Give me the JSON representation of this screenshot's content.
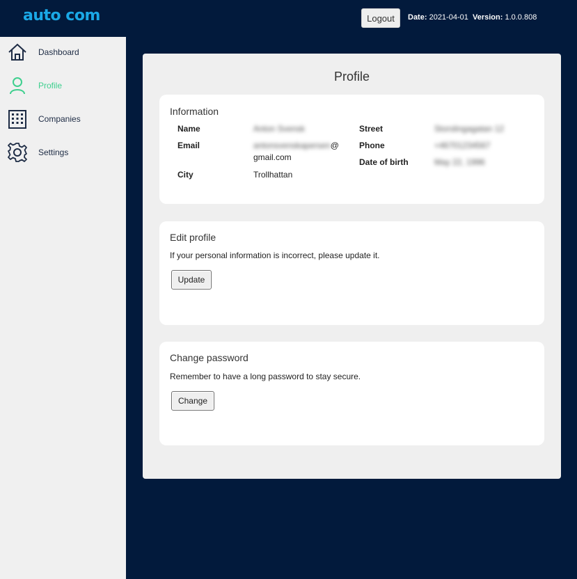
{
  "header": {
    "logo": "auto com",
    "logout_label": "Logout",
    "date_label": "Date:",
    "date_value": "2021-04-01",
    "version_label": "Version:",
    "version_value": "1.0.0.808"
  },
  "sidebar": {
    "items": [
      {
        "label": "Dashboard",
        "icon": "home-icon"
      },
      {
        "label": "Profile",
        "icon": "user-icon",
        "active": true
      },
      {
        "label": "Companies",
        "icon": "building-icon"
      },
      {
        "label": "Settings",
        "icon": "gear-icon"
      }
    ]
  },
  "main": {
    "title": "Profile",
    "information": {
      "title": "Information",
      "name_label": "Name",
      "name_value": "Anton Svensk",
      "email_label": "Email",
      "email_value_blurred": "antonsvenskapersen",
      "email_at": "@",
      "email_domain": "gmail.com",
      "city_label": "City",
      "city_value": "Trollhattan",
      "street_label": "Street",
      "street_value": "Storslingagatan 12",
      "phone_label": "Phone",
      "phone_value": "+46701234567",
      "dob_label": "Date of birth",
      "dob_value": "May 22, 1996"
    },
    "edit_profile": {
      "title": "Edit profile",
      "description": "If your personal information is incorrect, please update it.",
      "button_label": "Update"
    },
    "change_password": {
      "title": "Change password",
      "description": "Remember to have a long password to stay secure.",
      "button_label": "Change"
    }
  },
  "colors": {
    "background": "#021a3c",
    "accent_active": "#3ecf8e",
    "logo": "#1aa8e6"
  }
}
